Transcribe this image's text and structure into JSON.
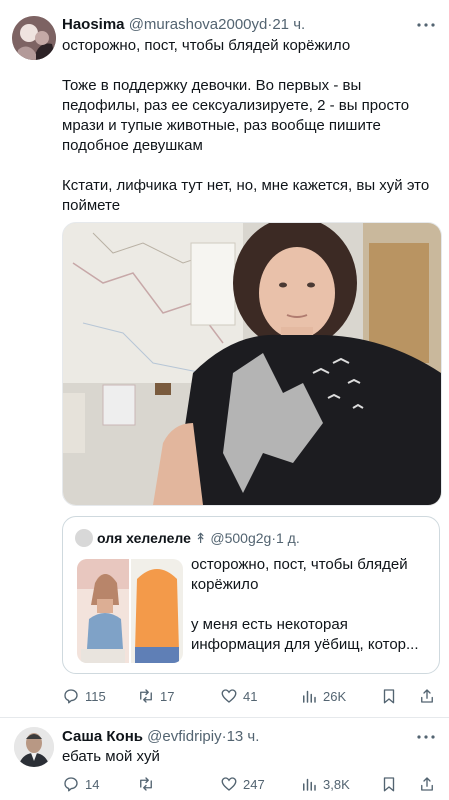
{
  "main_tweet": {
    "display_name": "Haosima",
    "handle": "@murashova2000yd",
    "separator": "·",
    "time": "21 ч.",
    "paragraphs": [
      "осторожно, пост, чтобы блядей корёжило",
      "Тоже в поддержку девочки. Во первых - вы педофилы, раз ее сексуализируете, 2 - вы просто мрази и тупые животные, раз вообще пишите подобное девушкам",
      "Кстати, лифчика тут нет, но, мне кажется, вы хуй это поймете"
    ],
    "quote": {
      "display_name": "оля хелелеле",
      "badge": "↟",
      "handle": "@500g2g",
      "separator": "·",
      "time": "1 д.",
      "paragraphs": [
        "осторожно, пост, чтобы блядей корёжило",
        "у меня есть некоторая информация для уёбищ, котор..."
      ]
    },
    "actions": {
      "replies": "115",
      "retweets": "17",
      "likes": "41",
      "views": "26K"
    }
  },
  "reply_tweet": {
    "display_name": "Саша Конь",
    "handle": "@evfidripiy",
    "separator": "·",
    "time": "13 ч.",
    "text": "ебать мой хуй",
    "actions": {
      "replies": "14",
      "retweets": "",
      "likes": "247",
      "views": "3,8K"
    }
  },
  "colors": {
    "text_primary": "#0f1419",
    "text_secondary": "#536471",
    "border": "#cfd9de"
  },
  "icons": {
    "reply": "speech-bubble-icon",
    "retweet": "retweet-arrows-icon",
    "like": "heart-icon",
    "views": "bar-chart-icon",
    "bookmark": "bookmark-icon",
    "share": "share-upload-icon",
    "more": "ellipsis-icon"
  }
}
